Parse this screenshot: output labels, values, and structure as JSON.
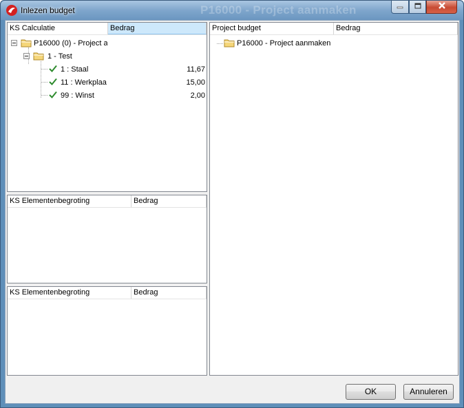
{
  "window": {
    "title": "Inlezen budget",
    "background_title": "P16000 - Project aanmaken"
  },
  "panels": {
    "calculatie": {
      "columns": [
        "KS Calculatie",
        "Bedrag"
      ],
      "tree": {
        "root_label": "P16000 (0) - Project a",
        "group_label": "1 - Test",
        "items": [
          {
            "label": "1 : Staal",
            "value": "11,67"
          },
          {
            "label": "11 : Werkplaa",
            "value": "15,00"
          },
          {
            "label": "99 : Winst",
            "value": "2,00"
          }
        ]
      }
    },
    "elementen1": {
      "columns": [
        "KS Elementenbegroting",
        "Bedrag"
      ]
    },
    "elementen2": {
      "columns": [
        "KS Elementenbegroting",
        "Bedrag"
      ]
    },
    "project_budget": {
      "columns": [
        "Project budget",
        "Bedrag"
      ],
      "root_label": "P16000 - Project aanmaken"
    }
  },
  "buttons": {
    "ok": "OK",
    "cancel": "Annuleren"
  },
  "colors": {
    "check": "#2e8b2e",
    "folder": "#f5d67a",
    "selected_header": "#cde8fb"
  }
}
